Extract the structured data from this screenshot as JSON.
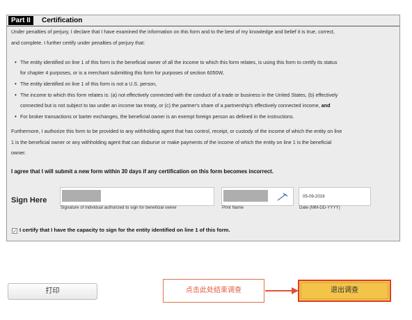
{
  "form": {
    "part_label": "Part II",
    "part_title": "Certification",
    "intro_line1": "Under penalties of perjury, I declare that I have examined the information on this form and to the best of my knowledge and belief it is true, correct,",
    "intro_line2": "and complete. I further certify under penalties of perjury that:",
    "bullets": [
      {
        "line1": "The entity identified on line 1 of this form is the beneficial owner of all the income to which this form relates, is using this form to certify its status",
        "line2": "for chapter 4 purposes, or is a merchant submitting this form for purposes of section 6050W,"
      },
      {
        "line1": "The entity identified on line 1 of this form is not a U.S. person,"
      },
      {
        "line1": "The income to which this form relates is: (a) not effectively connected with the conduct of a trade or business in the United States, (b) effectively",
        "line2": "connected but is not subject to tax under an income tax treaty, or (c) the partner's share of a partnership's effectively connected income,",
        "line2_bold": "and"
      },
      {
        "line1": "For broker transactions or barter exchanges, the beneficial owner is an exempt foreign person as defined in the instructions."
      }
    ],
    "furthermore_line1": "Furthermore, I authorize this form to be provided to any withholding agent that has control, receipt, or custody of the income of which the entity on line",
    "furthermore_line2": "1 is the beneficial owner or any withholding agent that can disburse or make payments of the income of which the entity on line 1 is the beneficial",
    "furthermore_line3": "owner.",
    "agree_text": "I agree that I will submit a new form within 30 days if any certification on this form becomes incorrect.",
    "sign_here": "Sign Here",
    "signature_caption": "Signature of individual authorized to sign for beneficial owner",
    "print_name_caption": "Print Name",
    "date_value": "05-09-2016",
    "date_caption": "Date (MM-DD-YYYY)",
    "capacity_text": "I certify that I have the capacity to sign for the entity identified on line 1 of this form.",
    "capacity_checked_glyph": "✓"
  },
  "footer": {
    "print_label": "打印",
    "callout_text": "点击此处结束调查",
    "exit_label": "退出调查"
  },
  "colors": {
    "form_bg": "#ececec",
    "callout_border": "#e0704a",
    "exit_bg": "#f4c44a",
    "exit_border": "#e23a2a"
  },
  "icons": {
    "pen": "pen-icon",
    "arrow": "arrow-right-icon"
  }
}
